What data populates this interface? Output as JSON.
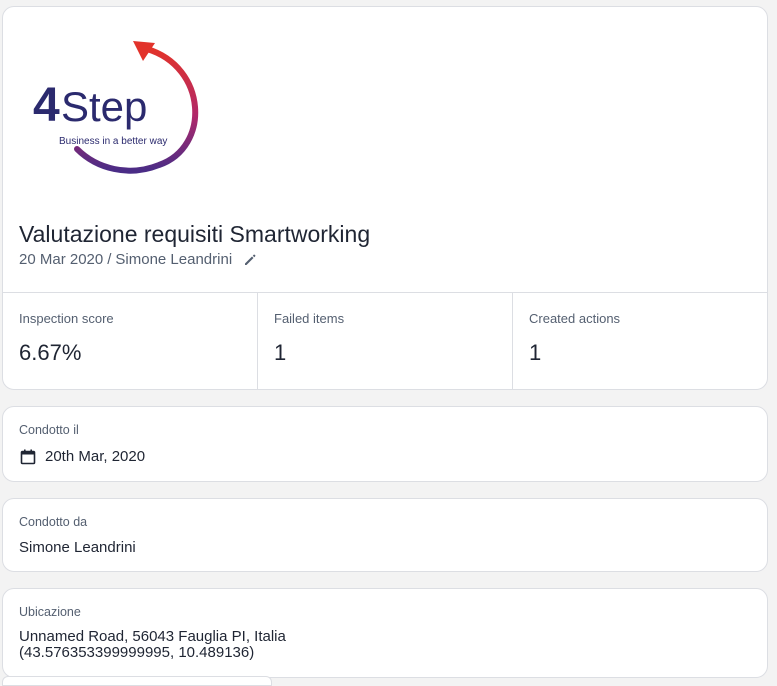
{
  "logo": {
    "brand_number": "4",
    "brand_word": "Step",
    "tagline": "Business in a better way",
    "colors": {
      "navy": "#2b2a6e",
      "red": "#e2332b",
      "purple": "#7b2d8e"
    }
  },
  "header": {
    "title": "Valutazione requisiti Smartworking",
    "date": "20 Mar 2020",
    "separator": "/",
    "author": "Simone Leandrini"
  },
  "stats": [
    {
      "label": "Inspection score",
      "value": "6.67%"
    },
    {
      "label": "Failed items",
      "value": "1"
    },
    {
      "label": "Created actions",
      "value": "1"
    }
  ],
  "conducted_on": {
    "label": "Condotto il",
    "value": "20th Mar, 2020"
  },
  "conducted_by": {
    "label": "Condotto da",
    "value": "Simone Leandrini"
  },
  "location": {
    "label": "Ubicazione",
    "address": "Unnamed Road, 56043 Fauglia PI, Italia",
    "coordinates": "(43.576353399999995, 10.489136)"
  }
}
